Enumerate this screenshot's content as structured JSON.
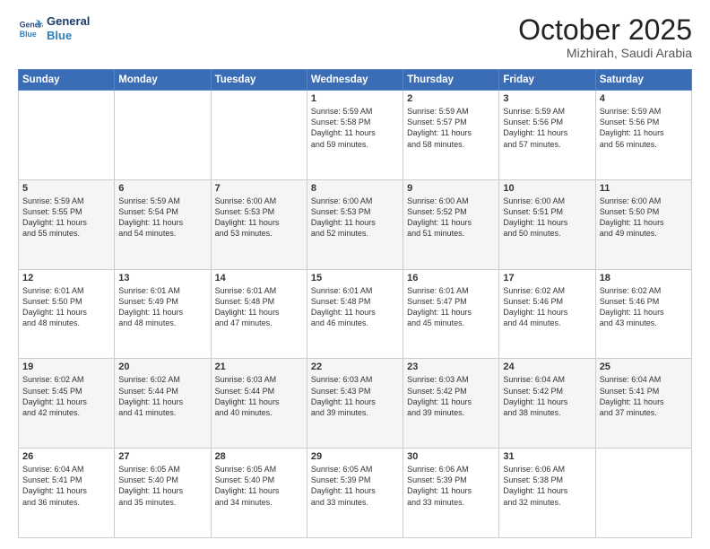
{
  "header": {
    "logo_line1": "General",
    "logo_line2": "Blue",
    "month": "October 2025",
    "location": "Mizhirah, Saudi Arabia"
  },
  "weekdays": [
    "Sunday",
    "Monday",
    "Tuesday",
    "Wednesday",
    "Thursday",
    "Friday",
    "Saturday"
  ],
  "weeks": [
    [
      {
        "day": "",
        "text": ""
      },
      {
        "day": "",
        "text": ""
      },
      {
        "day": "",
        "text": ""
      },
      {
        "day": "1",
        "text": "Sunrise: 5:59 AM\nSunset: 5:58 PM\nDaylight: 11 hours\nand 59 minutes."
      },
      {
        "day": "2",
        "text": "Sunrise: 5:59 AM\nSunset: 5:57 PM\nDaylight: 11 hours\nand 58 minutes."
      },
      {
        "day": "3",
        "text": "Sunrise: 5:59 AM\nSunset: 5:56 PM\nDaylight: 11 hours\nand 57 minutes."
      },
      {
        "day": "4",
        "text": "Sunrise: 5:59 AM\nSunset: 5:56 PM\nDaylight: 11 hours\nand 56 minutes."
      }
    ],
    [
      {
        "day": "5",
        "text": "Sunrise: 5:59 AM\nSunset: 5:55 PM\nDaylight: 11 hours\nand 55 minutes."
      },
      {
        "day": "6",
        "text": "Sunrise: 5:59 AM\nSunset: 5:54 PM\nDaylight: 11 hours\nand 54 minutes."
      },
      {
        "day": "7",
        "text": "Sunrise: 6:00 AM\nSunset: 5:53 PM\nDaylight: 11 hours\nand 53 minutes."
      },
      {
        "day": "8",
        "text": "Sunrise: 6:00 AM\nSunset: 5:53 PM\nDaylight: 11 hours\nand 52 minutes."
      },
      {
        "day": "9",
        "text": "Sunrise: 6:00 AM\nSunset: 5:52 PM\nDaylight: 11 hours\nand 51 minutes."
      },
      {
        "day": "10",
        "text": "Sunrise: 6:00 AM\nSunset: 5:51 PM\nDaylight: 11 hours\nand 50 minutes."
      },
      {
        "day": "11",
        "text": "Sunrise: 6:00 AM\nSunset: 5:50 PM\nDaylight: 11 hours\nand 49 minutes."
      }
    ],
    [
      {
        "day": "12",
        "text": "Sunrise: 6:01 AM\nSunset: 5:50 PM\nDaylight: 11 hours\nand 48 minutes."
      },
      {
        "day": "13",
        "text": "Sunrise: 6:01 AM\nSunset: 5:49 PM\nDaylight: 11 hours\nand 48 minutes."
      },
      {
        "day": "14",
        "text": "Sunrise: 6:01 AM\nSunset: 5:48 PM\nDaylight: 11 hours\nand 47 minutes."
      },
      {
        "day": "15",
        "text": "Sunrise: 6:01 AM\nSunset: 5:48 PM\nDaylight: 11 hours\nand 46 minutes."
      },
      {
        "day": "16",
        "text": "Sunrise: 6:01 AM\nSunset: 5:47 PM\nDaylight: 11 hours\nand 45 minutes."
      },
      {
        "day": "17",
        "text": "Sunrise: 6:02 AM\nSunset: 5:46 PM\nDaylight: 11 hours\nand 44 minutes."
      },
      {
        "day": "18",
        "text": "Sunrise: 6:02 AM\nSunset: 5:46 PM\nDaylight: 11 hours\nand 43 minutes."
      }
    ],
    [
      {
        "day": "19",
        "text": "Sunrise: 6:02 AM\nSunset: 5:45 PM\nDaylight: 11 hours\nand 42 minutes."
      },
      {
        "day": "20",
        "text": "Sunrise: 6:02 AM\nSunset: 5:44 PM\nDaylight: 11 hours\nand 41 minutes."
      },
      {
        "day": "21",
        "text": "Sunrise: 6:03 AM\nSunset: 5:44 PM\nDaylight: 11 hours\nand 40 minutes."
      },
      {
        "day": "22",
        "text": "Sunrise: 6:03 AM\nSunset: 5:43 PM\nDaylight: 11 hours\nand 39 minutes."
      },
      {
        "day": "23",
        "text": "Sunrise: 6:03 AM\nSunset: 5:42 PM\nDaylight: 11 hours\nand 39 minutes."
      },
      {
        "day": "24",
        "text": "Sunrise: 6:04 AM\nSunset: 5:42 PM\nDaylight: 11 hours\nand 38 minutes."
      },
      {
        "day": "25",
        "text": "Sunrise: 6:04 AM\nSunset: 5:41 PM\nDaylight: 11 hours\nand 37 minutes."
      }
    ],
    [
      {
        "day": "26",
        "text": "Sunrise: 6:04 AM\nSunset: 5:41 PM\nDaylight: 11 hours\nand 36 minutes."
      },
      {
        "day": "27",
        "text": "Sunrise: 6:05 AM\nSunset: 5:40 PM\nDaylight: 11 hours\nand 35 minutes."
      },
      {
        "day": "28",
        "text": "Sunrise: 6:05 AM\nSunset: 5:40 PM\nDaylight: 11 hours\nand 34 minutes."
      },
      {
        "day": "29",
        "text": "Sunrise: 6:05 AM\nSunset: 5:39 PM\nDaylight: 11 hours\nand 33 minutes."
      },
      {
        "day": "30",
        "text": "Sunrise: 6:06 AM\nSunset: 5:39 PM\nDaylight: 11 hours\nand 33 minutes."
      },
      {
        "day": "31",
        "text": "Sunrise: 6:06 AM\nSunset: 5:38 PM\nDaylight: 11 hours\nand 32 minutes."
      },
      {
        "day": "",
        "text": ""
      }
    ]
  ]
}
